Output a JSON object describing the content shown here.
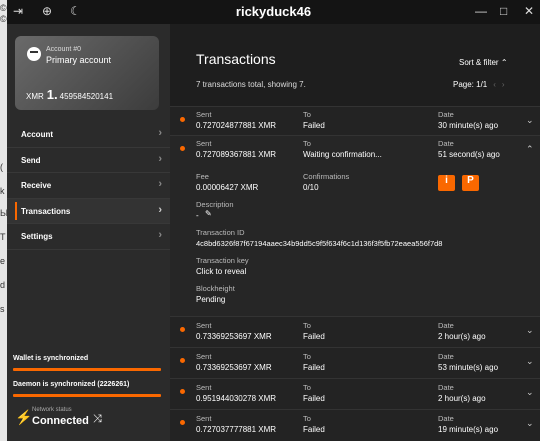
{
  "desktop_strip": [
    "©",
    "©",
    "(",
    "k",
    "Ы",
    "T",
    "e",
    "d",
    "s"
  ],
  "titlebar": {
    "title": "rickyduck46",
    "icons": [
      "exit-icon",
      "globe-icon",
      "moon-icon",
      "minimize-icon",
      "maximize-icon",
      "close-icon"
    ]
  },
  "account_card": {
    "subtitle": "Account #0",
    "name": "Primary account",
    "currency": "XMR",
    "balance_int": "1.",
    "balance_dec": "459584520141"
  },
  "menu": [
    {
      "label": "Account"
    },
    {
      "label": "Send"
    },
    {
      "label": "Receive"
    },
    {
      "label": "Transactions",
      "active": true
    },
    {
      "label": "Settings"
    }
  ],
  "status": {
    "wallet_sync": "Wallet is synchronized",
    "daemon_sync": "Daemon is synchronized (2226261)",
    "network_label": "Network status",
    "network_value": "Connected"
  },
  "transactions": {
    "title": "Transactions",
    "sort_label": "Sort & filter",
    "summary": "7 transactions total, showing 7.",
    "page_label": "Page: 1/1",
    "col_sent": "Sent",
    "col_to": "To",
    "col_date": "Date",
    "rows": [
      {
        "amount": "0.727024877881 XMR",
        "to": "Failed",
        "date": "30 minute(s) ago"
      },
      {
        "amount": "0.727089367881 XMR",
        "to": "Waiting confirmation...",
        "date": "51 second(s) ago"
      },
      {
        "amount": "0.73369253697 XMR",
        "to": "Failed",
        "date": "2 hour(s) ago"
      },
      {
        "amount": "0.73369253697 XMR",
        "to": "Failed",
        "date": "53 minute(s) ago"
      },
      {
        "amount": "0.951944030278 XMR",
        "to": "Failed",
        "date": "2 hour(s) ago"
      },
      {
        "amount": "0.727037777881 XMR",
        "to": "Failed",
        "date": "19 minute(s) ago"
      }
    ],
    "detail": {
      "fee_label": "Fee",
      "fee": "0.00006427 XMR",
      "conf_label": "Confirmations",
      "conf": "0/10",
      "desc_label": "Description",
      "desc": "-",
      "txid_label": "Transaction ID",
      "txid": "4c8bd6326f87f67194aaec34b9dd5c9f5f634f6c1d136f3f5fb72eaea556f7d8",
      "key_label": "Transaction key",
      "key": "Click to reveal",
      "block_label": "Blockheight",
      "block": "Pending"
    }
  }
}
